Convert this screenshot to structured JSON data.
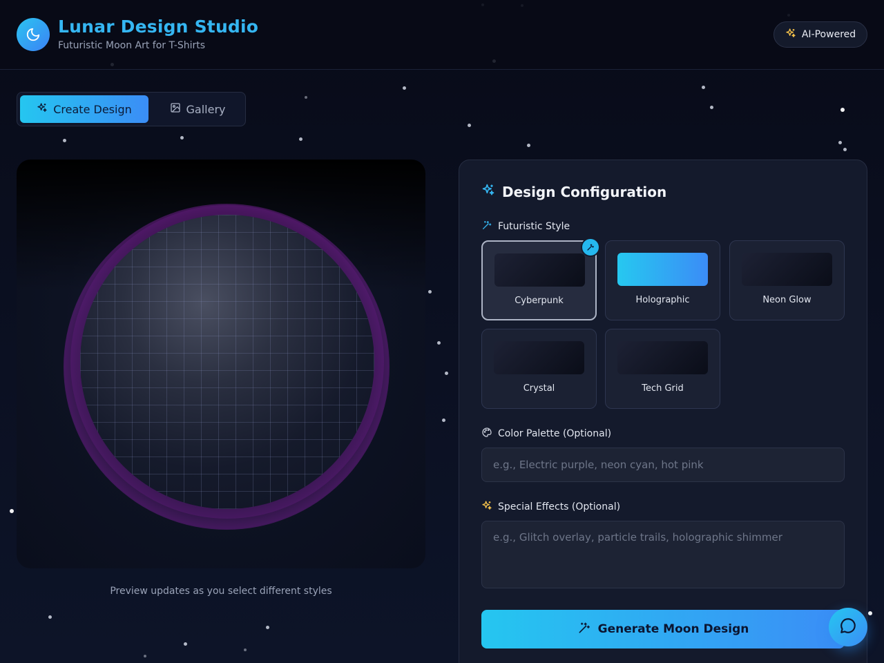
{
  "header": {
    "title": "Lunar Design Studio",
    "subtitle": "Futuristic Moon Art for T-Shirts",
    "logo_icon": "moon-icon",
    "badge": {
      "label": "AI-Powered",
      "icon": "sparkles-icon",
      "icon_color": "#f5c24b"
    }
  },
  "tabs": [
    {
      "label": "Create Design",
      "icon": "sparkles-icon",
      "active": true
    },
    {
      "label": "Gallery",
      "icon": "image-icon",
      "active": false
    }
  ],
  "preview": {
    "caption": "Preview updates as you select different styles"
  },
  "config": {
    "title": "Design Configuration",
    "style_section": {
      "label": "Futuristic Style",
      "options": [
        {
          "name": "Cyberpunk",
          "selected": true
        },
        {
          "name": "Holographic",
          "selected": false
        },
        {
          "name": "Neon Glow",
          "selected": false
        },
        {
          "name": "Crystal",
          "selected": false
        },
        {
          "name": "Tech Grid",
          "selected": false
        }
      ]
    },
    "color_palette": {
      "label": "Color Palette (Optional)",
      "value": "",
      "placeholder": "e.g., Electric purple, neon cyan, hot pink"
    },
    "special_effects": {
      "label": "Special Effects (Optional)",
      "value": "",
      "placeholder": "e.g., Glitch overlay, particle trails, holographic shimmer"
    },
    "generate_label": "Generate Moon Design"
  },
  "chat": {
    "icon": "chat-bubble-icon"
  },
  "colors": {
    "accent_start": "#25c6f0",
    "accent_end": "#3b8df6",
    "title_blue": "#35b6f2",
    "background": "#0a0e1c"
  }
}
